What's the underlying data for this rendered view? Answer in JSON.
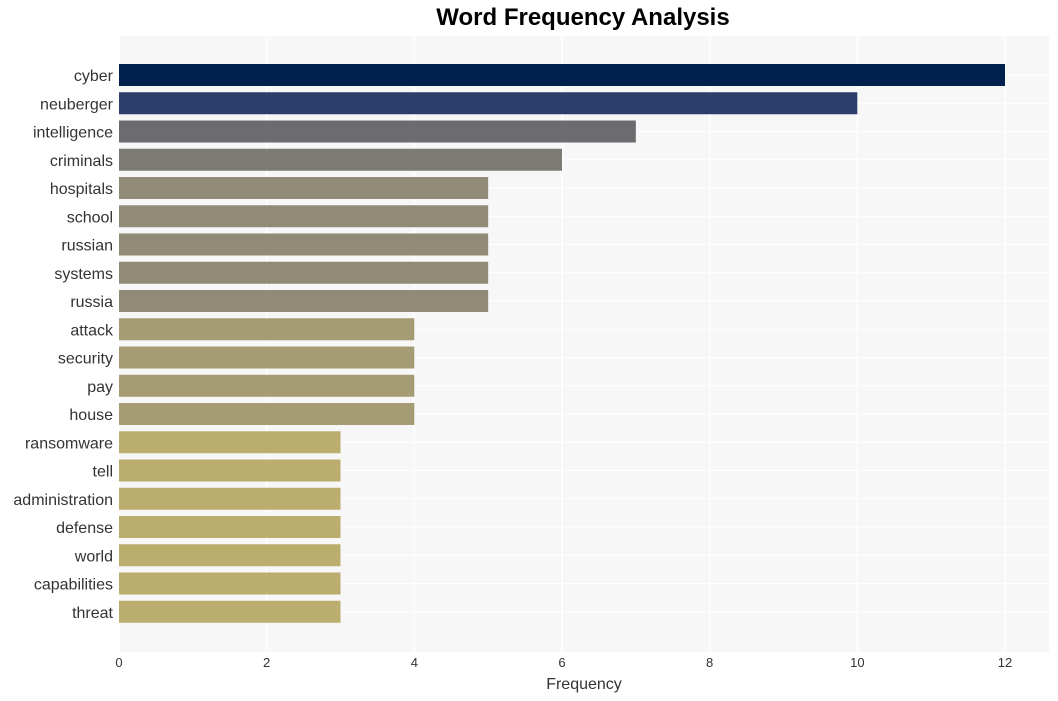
{
  "chart_data": {
    "type": "bar",
    "orientation": "horizontal",
    "title": "Word Frequency Analysis",
    "xlabel": "Frequency",
    "ylabel": "",
    "xlim": [
      0,
      12.6
    ],
    "xticks": [
      0,
      2,
      4,
      6,
      8,
      10,
      12
    ],
    "grid": true,
    "categories": [
      "cyber",
      "neuberger",
      "intelligence",
      "criminals",
      "hospitals",
      "school",
      "russian",
      "systems",
      "russia",
      "attack",
      "security",
      "pay",
      "house",
      "ransomware",
      "tell",
      "administration",
      "defense",
      "world",
      "capabilities",
      "threat"
    ],
    "values": [
      12,
      10,
      7,
      6,
      5,
      5,
      5,
      5,
      5,
      4,
      4,
      4,
      4,
      3,
      3,
      3,
      3,
      3,
      3,
      3
    ],
    "colors": [
      "#00214d",
      "#2c3e6b",
      "#6b6b70",
      "#7c7a75",
      "#918a76",
      "#918a76",
      "#918a76",
      "#918a76",
      "#918a76",
      "#a59c73",
      "#a59c73",
      "#a59c73",
      "#a59c73",
      "#bbad6e",
      "#bbad6e",
      "#bbad6e",
      "#bbad6e",
      "#bbad6e",
      "#bbad6e",
      "#bbad6e"
    ],
    "background": "#f7f7f7"
  }
}
